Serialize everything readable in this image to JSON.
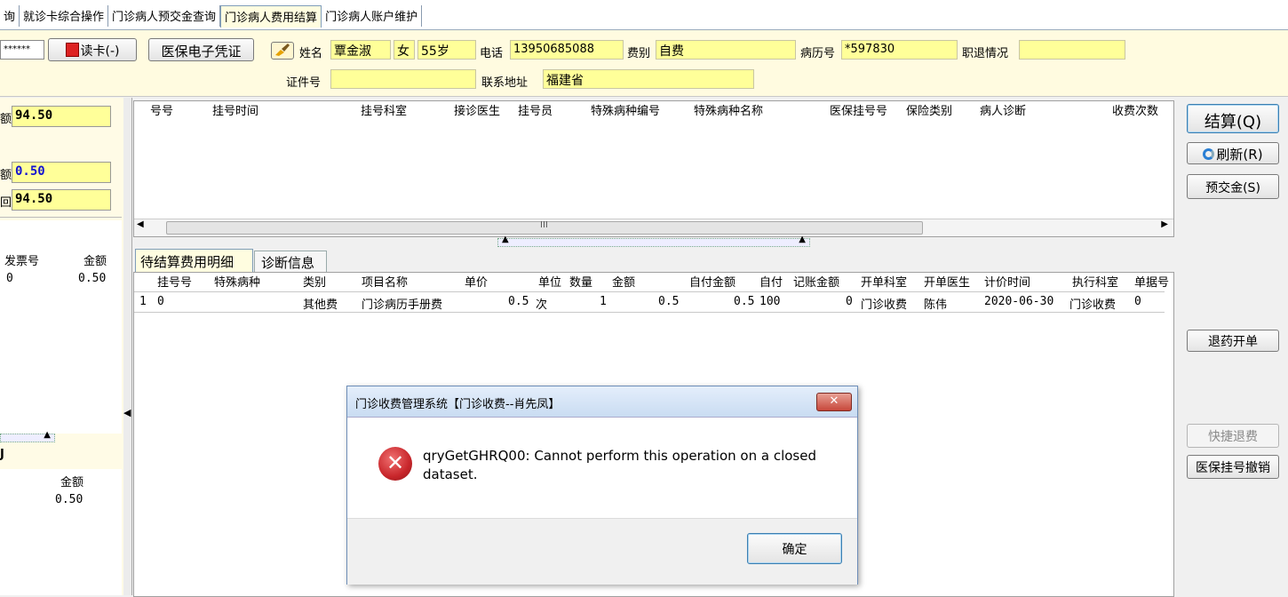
{
  "tabs": [
    "询",
    "就诊卡综合操作",
    "门诊病人预交金查询",
    "门诊病人费用结算",
    "门诊病人账户维护"
  ],
  "header": {
    "card_mask": "******",
    "read_card_button": "读卡(-)",
    "insurance_voucher_button": "医保电子凭证",
    "name_label": "姓名",
    "name_value": "覃金淑",
    "gender_value": "女",
    "age_value": "55岁",
    "phone_label": "电话",
    "phone_value": "13950685088",
    "fee_type_label": "费别",
    "fee_type_value": "自费",
    "record_no_label": "病历号",
    "record_no_value": "*597830",
    "retire_label": "职退情况",
    "retire_value": "",
    "id_label": "证件号",
    "id_value": "",
    "address_label": "联系地址",
    "address_value": "福建省"
  },
  "left_panel": {
    "amount1_label": "额",
    "amount1_value": "94.50",
    "amount2_label": "额",
    "amount2_value": "0.50",
    "amount3_label": "回",
    "amount3_value": "94.50",
    "invoice_headers": [
      "发票号",
      "金额"
    ],
    "invoice_rows": [
      {
        "invoice": "0",
        "amount": "0.50"
      }
    ],
    "bottom_marker": "J",
    "bottom_header": "金额",
    "bottom_rows": [
      "0.50"
    ]
  },
  "registration_grid": {
    "headers": [
      "号号",
      "挂号时间",
      "挂号科室",
      "接诊医生",
      "挂号员",
      "特殊病种编号",
      "特殊病种名称",
      "医保挂号号",
      "保险类别",
      "病人诊断",
      "收费次数"
    ],
    "scroll_marker": "III"
  },
  "detail_tabs": [
    "待结算费用明细",
    "诊断信息"
  ],
  "detail_grid": {
    "headers": [
      "挂号号",
      "特殊病种",
      "类别",
      "项目名称",
      "单价",
      "单位",
      "数量",
      "金额",
      "自付金额",
      "自付",
      "记账金额",
      "开单科室",
      "开单医生",
      "计价时间",
      "执行科室",
      "单据号"
    ],
    "rows": [
      {
        "idx": "1",
        "reg_no": "0",
        "special": "",
        "category": "其他费",
        "item": "门诊病历手册费",
        "price": "0.5",
        "unit": "次",
        "qty": "1",
        "amount": "0.5",
        "self_amount": "0.5",
        "self_pct": "100",
        "charge_amount": "0",
        "dept": "门诊收费",
        "doctor": "陈伟",
        "time": "2020-06-30",
        "exec_dept": "门诊收费",
        "bill_no": "0"
      }
    ]
  },
  "right_buttons": {
    "settle": "结算(Q)",
    "refresh": "刷新(R)",
    "prepay": "预交金(S)",
    "return_drug": "退药开单",
    "quick_refund": "快捷退费",
    "cancel_insurance_reg": "医保挂号撤销"
  },
  "dialog": {
    "title": "门诊收费管理系统【门诊收费--肖先凤】",
    "message": "qryGetGHRQ00: Cannot perform this operation on a closed dataset.",
    "ok_button": "确定"
  },
  "colors": {
    "field_yellow": "#ffff99",
    "panel_cream": "#fffbe0",
    "error_red": "#c8262b",
    "dialog_title_blue": "#c9dcf2"
  }
}
